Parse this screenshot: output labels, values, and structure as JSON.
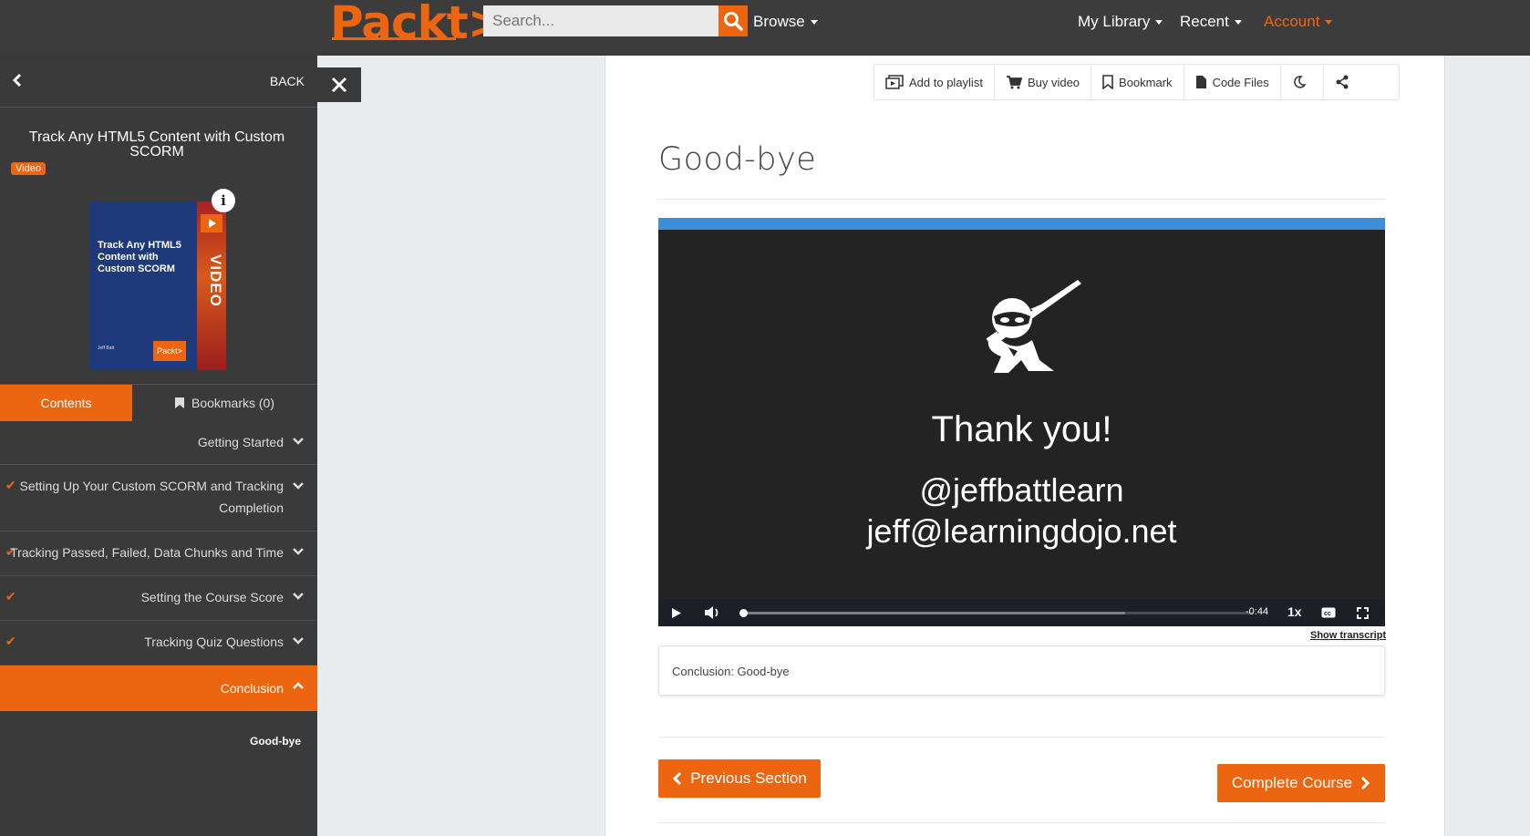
{
  "header": {
    "logo_text": "Packt>",
    "search_placeholder": "Search...",
    "nav": {
      "browse": "Browse",
      "my_library": "My Library",
      "recent": "Recent",
      "account": "Account"
    }
  },
  "sidebar": {
    "back_label": "BACK",
    "course_title": "Track Any HTML5 Content with Custom SCORM",
    "badge": "Video",
    "cover": {
      "title": "Track Any HTML5 Content with Custom SCORM",
      "author": "Jeff Batt",
      "brand": "Packt>",
      "strip_text": "VIDEO"
    },
    "info_label": "i",
    "tabs": {
      "contents": "Contents",
      "bookmarks": "Bookmarks (0)"
    },
    "sections": [
      {
        "label": "Getting Started"
      },
      {
        "label_line1": "Setting Up Your Custom SCORM and Tracking",
        "label_line2": "Completion"
      },
      {
        "label": "Tracking Passed, Failed, Data Chunks and Time"
      },
      {
        "label": "Setting the Course Score"
      },
      {
        "label": "Tracking Quiz Questions"
      },
      {
        "label": "Conclusion"
      }
    ],
    "sub_item": "Good-bye"
  },
  "toolbar": {
    "add_to_playlist": "Add to playlist",
    "buy_video": "Buy video",
    "bookmark": "Bookmark",
    "code_files": "Code Files"
  },
  "main": {
    "title": "Good-bye",
    "slide": {
      "thanks": "Thank you!",
      "handle": "@jeffbattlearn",
      "email": "jeff@learningdojo.net"
    },
    "player": {
      "time_remaining": "-0:44",
      "speed": "1x",
      "progress": 0.0
    },
    "show_transcript": "Show transcript",
    "description": "Conclusion: Good-bye",
    "prev_button": "Previous Section",
    "complete_button": "Complete Course"
  },
  "colors": {
    "brand": "#ec6611",
    "sidebar_bg": "#3a3a3a",
    "topbar_bg": "#3c3c3c",
    "player_bar": "#3a8fd8"
  }
}
